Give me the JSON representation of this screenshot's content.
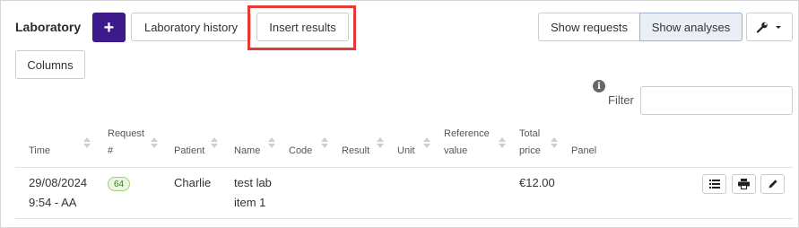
{
  "header": {
    "title": "Laboratory",
    "add_label": "+",
    "history_label": "Laboratory history",
    "insert_label": "Insert results",
    "show_requests_label": "Show requests",
    "show_analyses_label": "Show analyses",
    "columns_label": "Columns",
    "tools_icon": "wrench-icon"
  },
  "filter": {
    "label": "Filter",
    "value": "",
    "info_icon": "i"
  },
  "table": {
    "columns": [
      "Time",
      "Request #",
      "Patient",
      "Name",
      "Code",
      "Result",
      "Unit",
      "Reference value",
      "Total price",
      "Panel"
    ],
    "column_lines": {
      "request": [
        "Request",
        "#"
      ],
      "reference": [
        "Reference",
        "value"
      ],
      "total": [
        "Total",
        "price"
      ]
    },
    "rows": [
      {
        "date": "29/08/2024",
        "time": "9:54 - AA",
        "request": "64",
        "patient": "Charlie",
        "name_line1": "test lab",
        "name_line2": "item 1",
        "code": "",
        "result": "",
        "unit": "",
        "reference": "",
        "total_price": "€12.00",
        "panel": ""
      }
    ]
  },
  "colors": {
    "accent": "#3c1a8c",
    "highlight": "#e53935",
    "badge_bg": "#eaf6e0",
    "badge_border": "#9dcf7d"
  }
}
